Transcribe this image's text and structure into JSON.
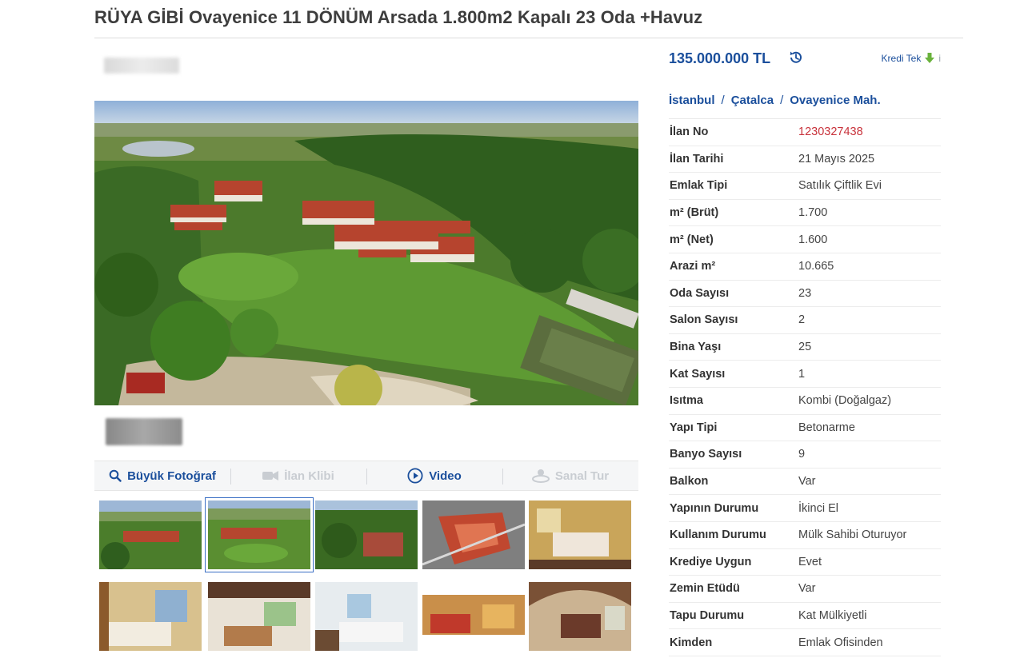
{
  "listing": {
    "title": "RÜYA GİBİ Ovayenice 11 DÖNÜM Arsada 1.800m2 Kapalı 23 Oda +Havuz"
  },
  "price": {
    "amount": "135.000.000 TL",
    "history_icon": "history-icon",
    "kredi_label": "Kredi Tek",
    "kredi_icon": "download-arrow-icon",
    "kredi_tail": "i"
  },
  "breadcrumb": [
    "İstanbul",
    "Çatalca",
    "Ovayenice Mah."
  ],
  "breadcrumb_separator": "/",
  "details": [
    {
      "label": "İlan No",
      "value": "1230327438"
    },
    {
      "label": "İlan Tarihi",
      "value": "21 Mayıs 2025"
    },
    {
      "label": "Emlak Tipi",
      "value": "Satılık Çiftlik Evi"
    },
    {
      "label": "m² (Brüt)",
      "value": "1.700"
    },
    {
      "label": "m² (Net)",
      "value": "1.600"
    },
    {
      "label": "Arazi m²",
      "value": "10.665"
    },
    {
      "label": "Oda Sayısı",
      "value": "23"
    },
    {
      "label": "Salon Sayısı",
      "value": "2"
    },
    {
      "label": "Bina Yaşı",
      "value": "25"
    },
    {
      "label": "Kat Sayısı",
      "value": "1"
    },
    {
      "label": "Isıtma",
      "value": "Kombi (Doğalgaz)"
    },
    {
      "label": "Yapı Tipi",
      "value": "Betonarme"
    },
    {
      "label": "Banyo Sayısı",
      "value": "9"
    },
    {
      "label": "Balkon",
      "value": "Var"
    },
    {
      "label": "Yapının Durumu",
      "value": "İkinci El"
    },
    {
      "label": "Kullanım Durumu",
      "value": "Mülk Sahibi Oturuyor"
    },
    {
      "label": "Krediye Uygun",
      "value": "Evet"
    },
    {
      "label": "Zemin Etüdü",
      "value": "Var"
    },
    {
      "label": "Tapu Durumu",
      "value": "Kat Mülkiyetli"
    },
    {
      "label": "Kimden",
      "value": "Emlak Ofisinden"
    }
  ],
  "photo_toolbar": {
    "large_photo": "Büyük Fotoğraf",
    "listing_clip": "İlan Klibi",
    "video": "Video",
    "virtual_tour": "Sanal Tur"
  },
  "colors": {
    "accent": "#1b4f9c",
    "listing_no": "#c8323b",
    "kredi_arrow": "#6ab23c"
  }
}
